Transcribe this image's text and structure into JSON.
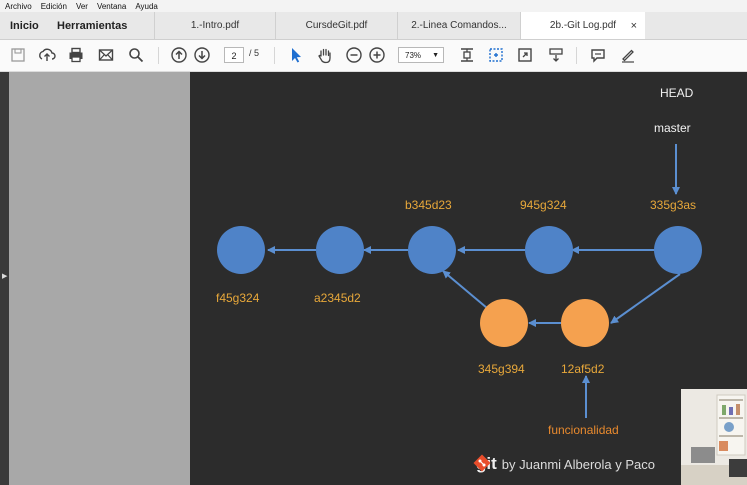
{
  "menu": [
    "Archivo",
    "Edición",
    "Ver",
    "Ventana",
    "Ayuda"
  ],
  "nav": {
    "home": "Inicio",
    "tools": "Herramientas"
  },
  "tabs": [
    {
      "label": "1.-Intro.pdf",
      "active": false
    },
    {
      "label": "CursdeGit.pdf",
      "active": false
    },
    {
      "label": "2.-Linea Comandos...",
      "active": false
    },
    {
      "label": "2b.-Git Log.pdf",
      "active": true
    }
  ],
  "tab_close": "×",
  "toolbar": {
    "page_current": "2",
    "page_total": "/ 5",
    "zoom": "73%",
    "icons": [
      "save-icon",
      "upload-icon",
      "print-icon",
      "email-icon",
      "search-icon",
      "arrow-up-icon",
      "arrow-down-icon",
      "select-cursor-icon",
      "hand-icon",
      "zoom-out-icon",
      "zoom-in-icon",
      "fit-page-icon",
      "marquee-icon",
      "fullscreen-icon",
      "scroll-mode-icon",
      "comment-icon",
      "sign-icon"
    ]
  },
  "slide": {
    "head": "HEAD",
    "master": "master",
    "commits_top_labels": [
      "b345d23",
      "945g324",
      "335g3as"
    ],
    "commits_bottom_labels": [
      "f45g324",
      "a2345d2"
    ],
    "branch_labels": [
      "345g394",
      "12af5d2"
    ],
    "branch_name": "funcionalidad",
    "credit_brand": "git",
    "credit_text": "by Juanmi Alberola y Paco"
  },
  "colors": {
    "main_commit": "#4f83c8",
    "branch_commit": "#f5a14f",
    "arrow": "#5b8fd1",
    "slide_bg": "#2c2c2c",
    "label_yellow": "#e8a83a",
    "git_orange": "#e84d2b"
  }
}
